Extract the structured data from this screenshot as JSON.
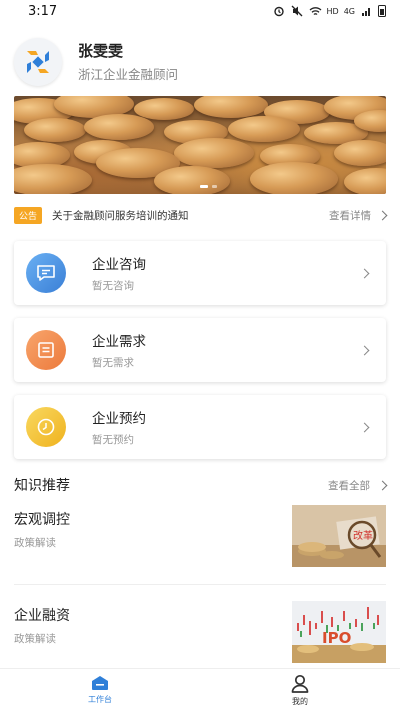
{
  "status_bar": {
    "time": "3:17",
    "network": "HD",
    "signal": "4G",
    "icons": [
      "alarm-icon",
      "mute-icon",
      "wifi-icon",
      "signal-icon",
      "battery-icon"
    ]
  },
  "profile": {
    "name": "张雯雯",
    "subtitle": "浙江企业金融顾问"
  },
  "banner": {
    "slides": 2,
    "active_slide": 1
  },
  "notice": {
    "tag": "公告",
    "text": "关于金融顾问服务培训的通知",
    "more": "查看详情"
  },
  "cards": [
    {
      "title": "企业咨询",
      "subtitle": "暂无咨询",
      "icon": "message-icon",
      "color": "#4a8fe0"
    },
    {
      "title": "企业需求",
      "subtitle": "暂无需求",
      "icon": "document-icon",
      "color": "#f08a4b"
    },
    {
      "title": "企业预约",
      "subtitle": "暂无预约",
      "icon": "clock-icon",
      "color": "#f4c233"
    }
  ],
  "knowledge": {
    "title": "知识推荐",
    "more": "查看全部",
    "articles": [
      {
        "title": "宏观调控",
        "tag": "政策解读",
        "thumb_text": "改革"
      },
      {
        "title": "企业融资",
        "tag": "政策解读",
        "thumb_text": "IPO"
      }
    ]
  },
  "tabbar": {
    "workbench": "工作台",
    "mine": "我的",
    "active": "workbench",
    "accent": "#2f7fd8"
  }
}
